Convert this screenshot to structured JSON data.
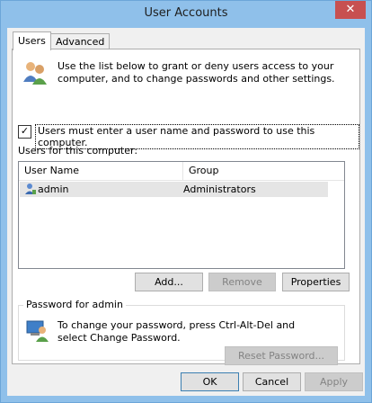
{
  "window": {
    "title": "User Accounts",
    "close_glyph": "✕"
  },
  "tabs": [
    {
      "label": "Users",
      "active": true
    },
    {
      "label": "Advanced",
      "active": false
    }
  ],
  "users_tab": {
    "intro_text": "Use the list below to grant or deny users access to your computer, and to change passwords and other settings.",
    "require_login_label": "Users must enter a user name and password to use this computer.",
    "require_login_checked": true,
    "users_label": "Users for this computer:",
    "columns": [
      "User Name",
      "Group"
    ],
    "rows": [
      {
        "user": "admin",
        "group": "Administrators"
      }
    ],
    "buttons": {
      "add": "Add...",
      "remove": "Remove",
      "properties": "Properties"
    },
    "password_group": {
      "title": "Password for admin",
      "text": "To change your password, press Ctrl-Alt-Del and select Change Password.",
      "reset_button": "Reset Password..."
    }
  },
  "footer": {
    "ok": "OK",
    "cancel": "Cancel",
    "apply": "Apply"
  },
  "icons": {
    "users": "users-icon",
    "user_row": "user-icon",
    "password_user": "user-password-icon"
  },
  "colors": {
    "title_bar": "#8fc0ea",
    "close_button": "#c75050",
    "accent": "#3c7fb1"
  }
}
